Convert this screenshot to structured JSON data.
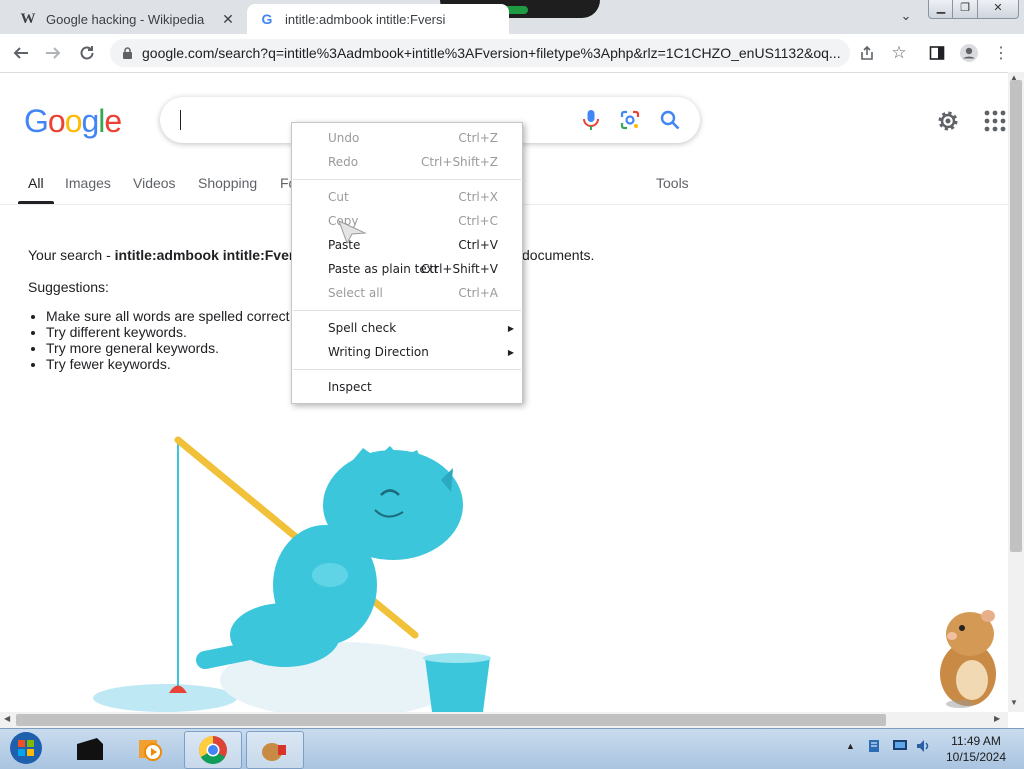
{
  "browser": {
    "tabs": [
      {
        "title": "Google hacking - Wikipedia",
        "favicon": "wikipedia-w-icon",
        "active": false
      },
      {
        "title": "intitle:admbook intitle:Fversi",
        "favicon": "google-g-icon",
        "active": true
      }
    ],
    "url": "google.com/search?q=intitle%3Aadmbook+intitle%3AFversion+filetype%3Aphp&rlz=1C1CHZO_enUS1132&oq..."
  },
  "google": {
    "logo_text": "Google",
    "search_value": "",
    "tabs": [
      "All",
      "Images",
      "Videos",
      "Shopping",
      "Fo",
      "Tools"
    ],
    "no_results_prefix": "Your search - ",
    "no_results_query": "intitle:admbook intitle:Fvers",
    "no_results_suffix": "documents.",
    "suggestions_label": "Suggestions:",
    "suggestions": [
      "Make sure all words are spelled correct",
      "Try different keywords.",
      "Try more general keywords.",
      "Try fewer keywords."
    ]
  },
  "context_menu": {
    "items": [
      {
        "label": "Undo",
        "shortcut": "Ctrl+Z",
        "enabled": false
      },
      {
        "label": "Redo",
        "shortcut": "Ctrl+Shift+Z",
        "enabled": false
      },
      {
        "label": "Cut",
        "shortcut": "Ctrl+X",
        "enabled": false
      },
      {
        "label": "Copy",
        "shortcut": "Ctrl+C",
        "enabled": false
      },
      {
        "label": "Paste",
        "shortcut": "Ctrl+V",
        "enabled": true
      },
      {
        "label": "Paste as plain text",
        "shortcut": "Ctrl+Shift+V",
        "enabled": true
      },
      {
        "label": "Select all",
        "shortcut": "Ctrl+A",
        "enabled": false
      },
      {
        "label": "Spell check",
        "shortcut": "",
        "enabled": true,
        "submenu": true
      },
      {
        "label": "Writing Direction",
        "shortcut": "",
        "enabled": true,
        "submenu": true
      },
      {
        "label": "Inspect",
        "shortcut": "",
        "enabled": true
      }
    ]
  },
  "taskbar": {
    "time": "11:49 AM",
    "date": "10/15/2024"
  },
  "colors": {
    "google_blue": "#4285F4",
    "google_red": "#EA4335",
    "google_yellow": "#FBBC05",
    "google_green": "#34A853",
    "illustration_teal": "#3cc6dc"
  }
}
